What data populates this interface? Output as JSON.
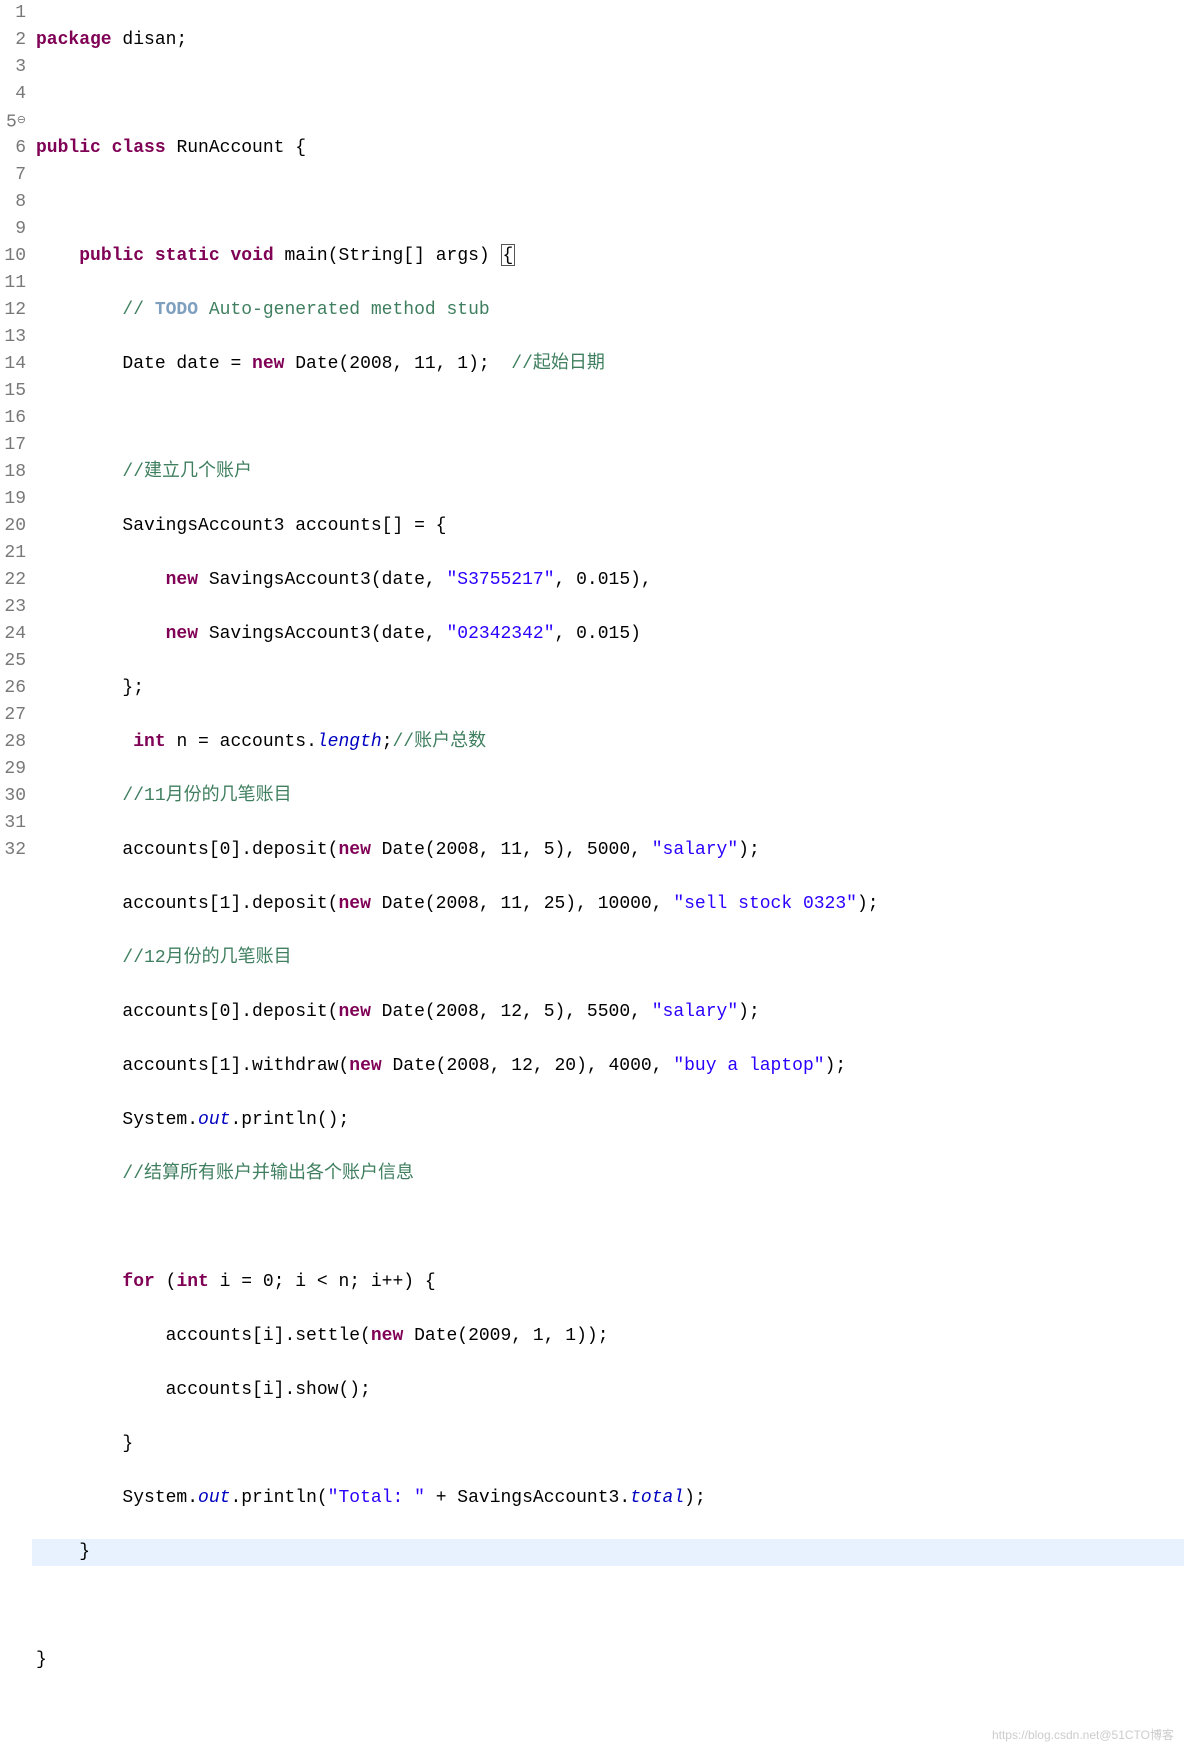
{
  "lines": {
    "1": "1",
    "2": "2",
    "3": "3",
    "4": "4",
    "5": "5",
    "6": "6",
    "7": "7",
    "8": "8",
    "9": "9",
    "10": "10",
    "11": "11",
    "12": "12",
    "13": "13",
    "14": "14",
    "15": "15",
    "16": "16",
    "17": "17",
    "18": "18",
    "19": "19",
    "20": "20",
    "21": "21",
    "22": "22",
    "23": "23",
    "24": "24",
    "25": "25",
    "26": "26",
    "27": "27",
    "28": "28",
    "29": "29",
    "30": "30",
    "31": "31",
    "32": "32"
  },
  "code": {
    "pkg_kw": "package",
    "pkg_name": " disan;",
    "public": "public",
    "class": "class",
    "class_name": " RunAccount {",
    "static": "static",
    "void": "void",
    "main_sig": " main(String[] args) ",
    "brace_open": "{",
    "todo_pre": "// ",
    "todo": "TODO",
    "todo_rest": " Auto-generated method stub",
    "date_decl": "Date date = ",
    "new": "new",
    "date_ctor": " Date(2008, 11, 1);  ",
    "date_comment": "//起始日期",
    "accounts_comment": "//建立几个账户",
    "accounts_decl": "SavingsAccount3 accounts[] = {",
    "sa_ctor1_pre": " SavingsAccount3(date, ",
    "sa_str1": "\"S3755217\"",
    "sa_ctor1_post": ", 0.015),",
    "sa_ctor2_pre": " SavingsAccount3(date, ",
    "sa_str2": "\"02342342\"",
    "sa_ctor2_post": ", 0.015)",
    "close_brace_semi": "};",
    "int_kw": "int",
    "n_decl": " n = accounts.",
    "length": "length",
    "n_decl_end": ";",
    "n_comment": "//账户总数",
    "month11_comment": "//11月份的几笔账目",
    "dep0_pre": "accounts[0].deposit(",
    "dep0_date": " Date(2008, 11, 5), 5000, ",
    "dep0_str": "\"salary\"",
    "dep0_post": ");",
    "dep1_pre": "accounts[1].deposit(",
    "dep1_date": " Date(2008, 11, 25), 10000, ",
    "dep1_str": "\"sell stock 0323\"",
    "dep1_post": ");",
    "month12_comment": "//12月份的几笔账目",
    "dep2_pre": "accounts[0].deposit(",
    "dep2_date": " Date(2008, 12, 5), 5500, ",
    "dep2_str": "\"salary\"",
    "dep2_post": ");",
    "wd_pre": "accounts[1].withdraw(",
    "wd_date": " Date(2008, 12, 20), 4000, ",
    "wd_str": "\"buy a laptop\"",
    "wd_post": ");",
    "sysout_pre": "System.",
    "out": "out",
    "println_empty": ".println();",
    "settle_comment": "//结算所有账户并输出各个账户信息",
    "for_kw": "for",
    "for_sig_pre": " (",
    "for_sig_mid": " i = 0; i < n; i++) {",
    "settle_pre": "accounts[i].settle(",
    "settle_date": " Date(2009, 1, 1));",
    "show_call": "accounts[i].show();",
    "close_brace": "}",
    "total_pre": ".println(",
    "total_str": "\"Total: \"",
    "total_mid": " + SavingsAccount3.",
    "total_field": "total",
    "total_post": ");",
    "close_class": "}",
    "indent1": "    ",
    "indent2": "        ",
    "indent3": "            ",
    "indent4": "                ",
    "space": " ",
    "space2": " "
  },
  "fold": "⊖",
  "watermark": "https://blog.csdn.net@51CTO博客"
}
